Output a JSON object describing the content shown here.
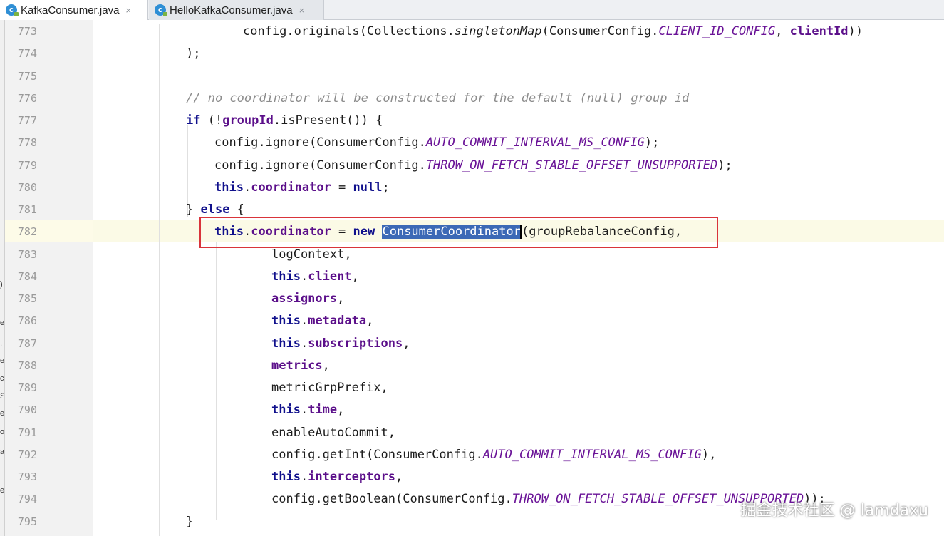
{
  "tabs": [
    {
      "label": "KafkaConsumer.java",
      "icon": "java-class-icon",
      "active": true,
      "close": "×"
    },
    {
      "label": "HelloKafkaConsumer.java",
      "icon": "java-class-icon",
      "active": false,
      "close": "×"
    }
  ],
  "tab_icon_letter": "c",
  "left_strip_fragments": [
    ")",
    "e",
    ",",
    "e",
    "c",
    "S",
    "e",
    "o",
    "a",
    "e"
  ],
  "lines": [
    {
      "n": "773",
      "tokens": [
        {
          "t": "config.originals(Collections.",
          "c": "pl"
        },
        {
          "t": "singletonMap",
          "c": "ital"
        },
        {
          "t": "(ConsumerConfig.",
          "c": "pl"
        },
        {
          "t": "CLIENT_ID_CONFIG",
          "c": "cst"
        },
        {
          "t": ", ",
          "c": "pl"
        },
        {
          "t": "clientId",
          "c": "fld"
        },
        {
          "t": "))",
          "c": "pl"
        }
      ]
    },
    {
      "n": "774",
      "tokens": [
        {
          "t": ");",
          "c": "pl"
        }
      ]
    },
    {
      "n": "775",
      "tokens": []
    },
    {
      "n": "776",
      "tokens": [
        {
          "t": "// no coordinator will be constructed for the default (null) group id",
          "c": "cm"
        }
      ]
    },
    {
      "n": "777",
      "tokens": [
        {
          "t": "if",
          "c": "kw"
        },
        {
          "t": " (!",
          "c": "pl"
        },
        {
          "t": "groupId",
          "c": "fld"
        },
        {
          "t": ".isPresent()) {",
          "c": "pl"
        }
      ]
    },
    {
      "n": "778",
      "tokens": [
        {
          "t": "config.ignore(ConsumerConfig.",
          "c": "pl"
        },
        {
          "t": "AUTO_COMMIT_INTERVAL_MS_CONFIG",
          "c": "cst"
        },
        {
          "t": ");",
          "c": "pl"
        }
      ]
    },
    {
      "n": "779",
      "tokens": [
        {
          "t": "config.ignore(ConsumerConfig.",
          "c": "pl"
        },
        {
          "t": "THROW_ON_FETCH_STABLE_OFFSET_UNSUPPORTED",
          "c": "cst"
        },
        {
          "t": ");",
          "c": "pl"
        }
      ]
    },
    {
      "n": "780",
      "tokens": [
        {
          "t": "this",
          "c": "kw"
        },
        {
          "t": ".",
          "c": "pl"
        },
        {
          "t": "coordinator",
          "c": "fld"
        },
        {
          "t": " = ",
          "c": "pl"
        },
        {
          "t": "null",
          "c": "kw"
        },
        {
          "t": ";",
          "c": "pl"
        }
      ]
    },
    {
      "n": "781",
      "tokens": [
        {
          "t": "} ",
          "c": "pl"
        },
        {
          "t": "else",
          "c": "kw"
        },
        {
          "t": " {",
          "c": "pl"
        }
      ]
    },
    {
      "n": "782",
      "tokens": [
        {
          "t": "this",
          "c": "kw"
        },
        {
          "t": ".",
          "c": "pl"
        },
        {
          "t": "coordinator",
          "c": "fld"
        },
        {
          "t": " = ",
          "c": "pl"
        },
        {
          "t": "new",
          "c": "kw"
        },
        {
          "t": " ",
          "c": "pl"
        },
        {
          "t": "ConsumerCoordinator",
          "c": "sel"
        },
        {
          "t": "",
          "c": "caret"
        },
        {
          "t": "(groupRebalanceConfig,",
          "c": "pl"
        }
      ]
    },
    {
      "n": "783",
      "tokens": [
        {
          "t": "logContext,",
          "c": "pl"
        }
      ]
    },
    {
      "n": "784",
      "tokens": [
        {
          "t": "this",
          "c": "kw"
        },
        {
          "t": ".",
          "c": "pl"
        },
        {
          "t": "client",
          "c": "fld"
        },
        {
          "t": ",",
          "c": "pl"
        }
      ]
    },
    {
      "n": "785",
      "tokens": [
        {
          "t": "assignors",
          "c": "fld"
        },
        {
          "t": ",",
          "c": "pl"
        }
      ]
    },
    {
      "n": "786",
      "tokens": [
        {
          "t": "this",
          "c": "kw"
        },
        {
          "t": ".",
          "c": "pl"
        },
        {
          "t": "metadata",
          "c": "fld"
        },
        {
          "t": ",",
          "c": "pl"
        }
      ]
    },
    {
      "n": "787",
      "tokens": [
        {
          "t": "this",
          "c": "kw"
        },
        {
          "t": ".",
          "c": "pl"
        },
        {
          "t": "subscriptions",
          "c": "fld"
        },
        {
          "t": ",",
          "c": "pl"
        }
      ]
    },
    {
      "n": "788",
      "tokens": [
        {
          "t": "metrics",
          "c": "fld"
        },
        {
          "t": ",",
          "c": "pl"
        }
      ]
    },
    {
      "n": "789",
      "tokens": [
        {
          "t": "metricGrpPrefix,",
          "c": "pl"
        }
      ]
    },
    {
      "n": "790",
      "tokens": [
        {
          "t": "this",
          "c": "kw"
        },
        {
          "t": ".",
          "c": "pl"
        },
        {
          "t": "time",
          "c": "fld"
        },
        {
          "t": ",",
          "c": "pl"
        }
      ]
    },
    {
      "n": "791",
      "tokens": [
        {
          "t": "enableAutoCommit,",
          "c": "pl"
        }
      ]
    },
    {
      "n": "792",
      "tokens": [
        {
          "t": "config.getInt(ConsumerConfig.",
          "c": "pl"
        },
        {
          "t": "AUTO_COMMIT_INTERVAL_MS_CONFIG",
          "c": "cst"
        },
        {
          "t": "),",
          "c": "pl"
        }
      ]
    },
    {
      "n": "793",
      "tokens": [
        {
          "t": "this",
          "c": "kw"
        },
        {
          "t": ".",
          "c": "pl"
        },
        {
          "t": "interceptors",
          "c": "fld"
        },
        {
          "t": ",",
          "c": "pl"
        }
      ]
    },
    {
      "n": "794",
      "tokens": [
        {
          "t": "config.getBoolean(ConsumerConfig.",
          "c": "pl"
        },
        {
          "t": "THROW_ON_FETCH_STABLE_OFFSET_UNSUPPORTED",
          "c": "cst"
        },
        {
          "t": "));",
          "c": "pl"
        }
      ]
    },
    {
      "n": "795",
      "tokens": [
        {
          "t": "}",
          "c": "pl"
        }
      ]
    }
  ],
  "watermark": "掘金技术社区 @ lamdaxu",
  "colors": {
    "highlight_box": "#d9343a",
    "selection": "#3c69b6",
    "keyword": "#10108c",
    "field": "#5b0f8a",
    "constant": "#6a1397"
  }
}
